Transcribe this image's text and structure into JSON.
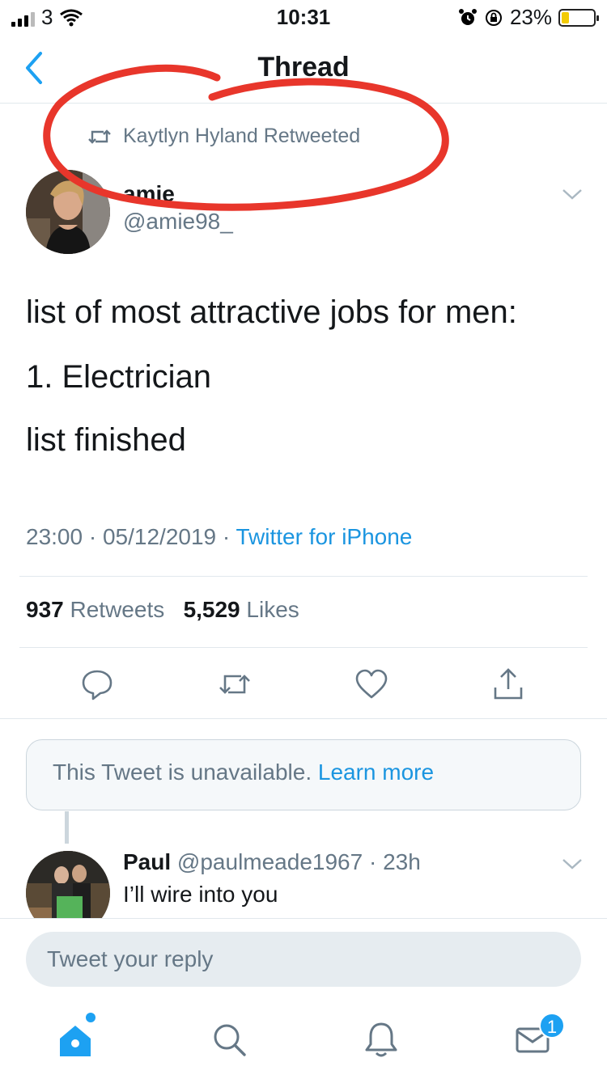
{
  "status_bar": {
    "carrier": "3",
    "time": "10:31",
    "battery_percent": "23%",
    "battery_level": 0.23,
    "icons": [
      "signal-icon",
      "wifi-icon",
      "alarm-icon",
      "orientation-lock-icon",
      "battery-icon"
    ]
  },
  "header": {
    "title": "Thread",
    "back_icon": "chevron-left-icon"
  },
  "tweet": {
    "retweeted_by": "Kaytlyn Hyland Retweeted",
    "author_name": "amie",
    "author_handle": "@amie98_",
    "lines": [
      "list of most attractive jobs for men:",
      "1. Electrician",
      "list finished"
    ],
    "time": "23:00",
    "date": "05/12/2019",
    "source": "Twitter for iPhone",
    "retweet_count": "937",
    "retweet_label": "Retweets",
    "like_count": "5,529",
    "like_label": "Likes",
    "actions": [
      "reply-icon",
      "retweet-icon",
      "like-icon",
      "share-icon"
    ]
  },
  "unavailable": {
    "message": "This Tweet is unavailable.",
    "link": "Learn more"
  },
  "reply": {
    "name": "Paul",
    "handle": "@paulmeade1967",
    "separator": "·",
    "age": "23h",
    "text": "I’ll wire into you"
  },
  "composer": {
    "placeholder": "Tweet your reply"
  },
  "tab_bar": {
    "tabs": [
      "home-icon",
      "search-icon",
      "notifications-icon",
      "messages-icon"
    ],
    "messages_badge": "1"
  },
  "colors": {
    "accent": "#1da1f2",
    "link": "#1b95e0",
    "secondary_text": "#657786",
    "annotation_red": "#e8362b"
  }
}
